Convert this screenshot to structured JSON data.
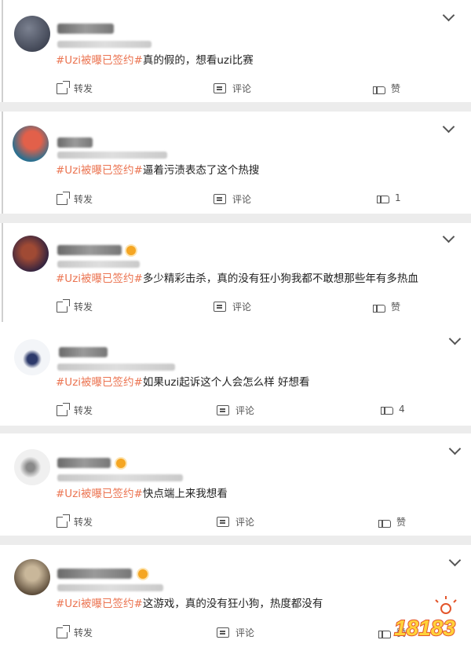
{
  "posts": [
    {
      "topic": "#Uzi被曝已签约#",
      "text": "真的假的，想看uzi比赛",
      "share": "转发",
      "comment": "评论",
      "like": "赞",
      "avatar": {
        "c1": "#5b6170",
        "c2": "#2c3140"
      }
    },
    {
      "topic": "#Uzi被曝已签约#",
      "text": "逼着污渍表态了这个热搜",
      "share": "转发",
      "comment": "评论",
      "like": "1",
      "avatar": {
        "c1": "#d94a3a",
        "c2": "#2b6f8f"
      }
    },
    {
      "topic": "#Uzi被曝已签约#",
      "text": "多少精彩击杀，真的没有狂小狗我都不敢想那些年有多热血",
      "share": "转发",
      "comment": "评论",
      "like": "赞",
      "avatar": {
        "c1": "#6b3a2a",
        "c2": "#2a2040"
      }
    },
    {
      "topic": "#Uzi被曝已签约#",
      "text": "如果uzi起诉这个人会怎么样 好想看",
      "share": "转发",
      "comment": "评论",
      "like": "4",
      "avatar": {
        "c1": "#e9eef5",
        "c2": "#2d3a6b"
      }
    },
    {
      "topic": "#Uzi被曝已签约#",
      "text": "快点端上来我想看",
      "share": "转发",
      "comment": "评论",
      "like": "赞",
      "avatar": {
        "c1": "#eeeeee",
        "c2": "#7a7a7a"
      }
    },
    {
      "topic": "#Uzi被曝已签约#",
      "text": "这游戏，真的没有狂小狗，热度都没有",
      "share": "转发",
      "comment": "评论",
      "like": "赞",
      "avatar": {
        "c1": "#b7a58a",
        "c2": "#5a4a38"
      }
    }
  ],
  "watermark": {
    "text": "18183",
    "colors": {
      "fill": "#ffd23a",
      "outline": "#e3552b"
    }
  }
}
